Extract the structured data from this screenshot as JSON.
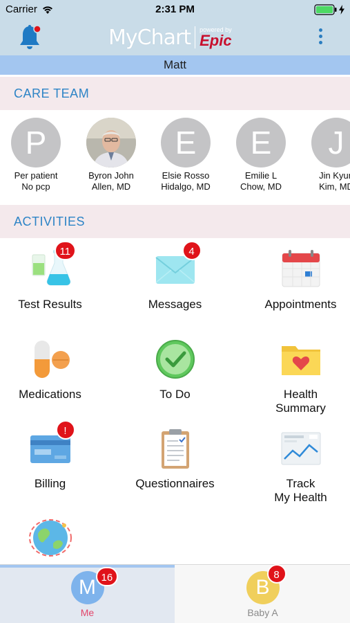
{
  "status_bar": {
    "carrier": "Carrier",
    "time": "2:31 PM"
  },
  "header": {
    "logo_text": "MyChart",
    "powered_by": "powered by",
    "epic": "Epic"
  },
  "patient": {
    "name": "Matt"
  },
  "care_team": {
    "title": "CARE TEAM",
    "members": [
      {
        "initial": "P",
        "name_line1": "Per patient",
        "name_line2": "No pcp",
        "has_photo": false
      },
      {
        "initial": "",
        "name_line1": "Byron John",
        "name_line2": "Allen, MD",
        "has_photo": true
      },
      {
        "initial": "E",
        "name_line1": "Elsie Rosso",
        "name_line2": "Hidalgo, MD",
        "has_photo": false
      },
      {
        "initial": "E",
        "name_line1": "Emilie L",
        "name_line2": "Chow, MD",
        "has_photo": false
      },
      {
        "initial": "J",
        "name_line1": "Jin Kyun",
        "name_line2": "Kim, MD",
        "has_photo": false
      }
    ]
  },
  "activities": {
    "title": "ACTIVITIES",
    "items": [
      {
        "label": "Test Results",
        "icon": "test-results-icon",
        "badge": "11"
      },
      {
        "label": "Messages",
        "icon": "messages-icon",
        "badge": "4"
      },
      {
        "label": "Appointments",
        "icon": "appointments-icon",
        "badge": ""
      },
      {
        "label": "Medications",
        "icon": "medications-icon",
        "badge": ""
      },
      {
        "label": "To Do",
        "icon": "todo-icon",
        "badge": ""
      },
      {
        "label_line1": "Health",
        "label_line2": "Summary",
        "icon": "health-summary-icon",
        "badge": ""
      },
      {
        "label": "Billing",
        "icon": "billing-icon",
        "badge": "!"
      },
      {
        "label": "Questionnaires",
        "icon": "questionnaires-icon",
        "badge": ""
      },
      {
        "label_line1": "Track",
        "label_line2": "My Health",
        "icon": "track-health-icon",
        "badge": ""
      },
      {
        "label": "",
        "icon": "globe-icon",
        "badge": ""
      }
    ]
  },
  "tabs": [
    {
      "initial": "M",
      "label": "Me",
      "badge": "16",
      "color": "#7eb3ec",
      "label_color": "#e2466b",
      "active": true
    },
    {
      "initial": "B",
      "label": "Baby A",
      "badge": "8",
      "color": "#f0cf5c",
      "label_color": "#8a8a8a",
      "active": false
    }
  ],
  "colors": {
    "accent": "#2d84c6",
    "badge": "#e0131a",
    "header_bg": "#c9dce8",
    "patient_bar": "#a3c6f0"
  }
}
